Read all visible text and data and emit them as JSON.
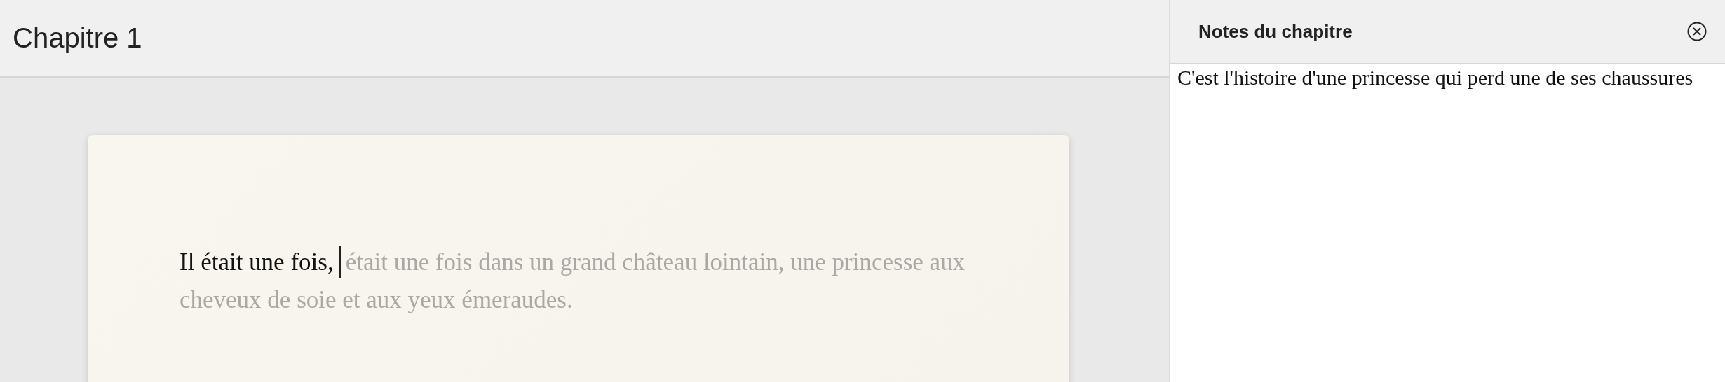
{
  "editor": {
    "title": "Chapitre 1",
    "typed_text": "Il était une fois,",
    "suggestion_lines": [
      "était une fois dans un grand château lointain, une princesse aux",
      "cheveux de soie et aux yeux émeraudes."
    ]
  },
  "notes_panel": {
    "title": "Notes du chapitre",
    "text": "C'est l'histoire d'une princesse qui perd une de ses chaussures"
  }
}
